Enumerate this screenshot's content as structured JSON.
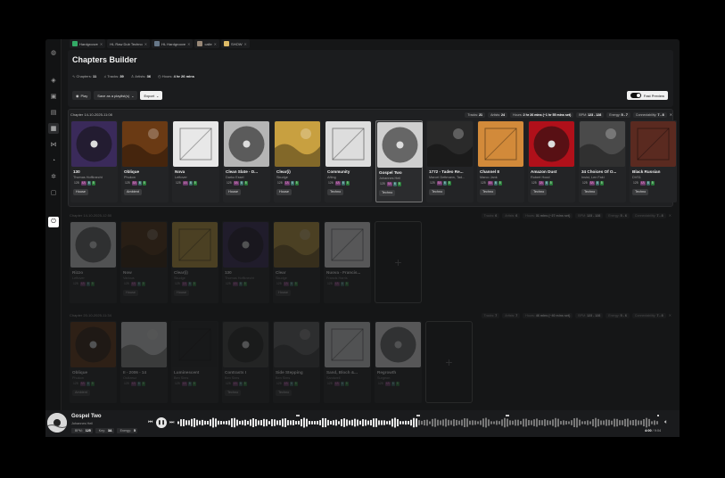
{
  "tabs": [
    {
      "label": "Hardgroove"
    },
    {
      "label": "HL Raw Dub Techno"
    },
    {
      "label": "HL Hardgroove"
    },
    {
      "label": "calle"
    },
    {
      "label": "SHOW"
    }
  ],
  "header": {
    "title": "Chapters Builder",
    "stats": {
      "chapters_label": "Chapters:",
      "chapters": "11",
      "tracks_label": "Tracks:",
      "tracks": "39",
      "artists_label": "Artists:",
      "artists": "36",
      "hours_label": "Hours:",
      "hours": "4 hr 26 mins"
    },
    "play_label": "Play",
    "save_label": "Save as a playlist(s)",
    "export_label": "Export",
    "fast_preview_label": "Fast Preview"
  },
  "chapters": [
    {
      "name": "Chapter 14-10-2025-11:08",
      "tracks_label": "Tracks:",
      "tracks": "21",
      "artists_label": "Artists:",
      "artists": "24",
      "hours_label": "Hours:",
      "hours": "2 hr 26 mins (~1 hr 55 mins set)",
      "bpm_label": "BPM:",
      "bpm": "123 - 128",
      "energy_label": "Energy:",
      "energy": "5 - 7",
      "connect_label": "Connectability:",
      "connect": "7 - 8"
    },
    {
      "name": "Chapter 14-10-2025-12:50",
      "tracks_label": "Tracks:",
      "tracks": "6",
      "artists_label": "Artists:",
      "artists": "6",
      "hours_label": "Hours:",
      "hours": "31 mins (~27 mins set)",
      "bpm_label": "BPM:",
      "bpm": "123 - 128",
      "energy_label": "Energy:",
      "energy": "5 - 6",
      "connect_label": "Connectability:",
      "connect": "7 - 8"
    },
    {
      "name": "Chapter 20-10-2025-11:34",
      "tracks_label": "Tracks:",
      "tracks": "7",
      "artists_label": "Artists:",
      "artists": "7",
      "hours_label": "Hours:",
      "hours": "46 mins (~40 mins set)",
      "bpm_label": "BPM:",
      "bpm": "123 - 128",
      "energy_label": "Energy:",
      "energy": "5 - 6",
      "connect_label": "Connectability:",
      "connect": "7 - 8"
    }
  ],
  "chapter1_tracks": [
    {
      "title": "130",
      "artist": "Thomas Hoffknecht",
      "bpm": "128",
      "key": "4A",
      "e1": "6",
      "e2": "5",
      "genre": "House",
      "cover": "#3a2a5a"
    },
    {
      "title": "Oblique",
      "artist": "Phukon",
      "bpm": "125",
      "key": "8A",
      "e1": "6",
      "e2": "5",
      "genre": "Ambient",
      "cover": "#6a3a14"
    },
    {
      "title": "Nova",
      "artist": "Leftover",
      "bpm": "125",
      "key": "4A",
      "e1": "6",
      "e2": "5",
      "genre": "",
      "cover": "#e8e8e8"
    },
    {
      "title": "Clean Slate - D...",
      "artist": "Darko Essel",
      "bpm": "125",
      "key": "5A",
      "e1": "6",
      "e2": "5",
      "genre": "House",
      "cover": "#b5b5b5"
    },
    {
      "title": "Clear(i)",
      "artist": "Skudge",
      "bpm": "128",
      "key": "1A",
      "e1": "6",
      "e2": "5",
      "genre": "House",
      "cover": "#c8a040"
    },
    {
      "title": "Community",
      "artist": "Afting",
      "bpm": "126",
      "key": "4A",
      "e1": "6",
      "e2": "5",
      "genre": "Techno",
      "cover": "#dddddd"
    },
    {
      "title": "Gospel Two",
      "artist": "Johannes Heil",
      "bpm": "125",
      "key": "5A",
      "e1": "6",
      "e2": "5",
      "genre": "Techno",
      "cover": "#cfcfcf"
    },
    {
      "title": "1772 - Tadeo Re...",
      "artist": "Marcel Dettmann, Tad...",
      "bpm": "125",
      "key": "8A",
      "e1": "6",
      "e2": "5",
      "genre": "Techno",
      "cover": "#2a2a2a"
    },
    {
      "title": "Channel 8",
      "artist": "Marco Jank",
      "bpm": "125",
      "key": "8A",
      "e1": "6",
      "e2": "5",
      "genre": "Techno",
      "cover": "#d28a3a"
    },
    {
      "title": "Amazon Dust",
      "artist": "Robert Hood",
      "bpm": "125",
      "key": "3A",
      "e1": "6",
      "e2": "5",
      "genre": "Techno",
      "cover": "#b0101a"
    },
    {
      "title": "34 Choices Of O...",
      "artist": "Insist, Len Faki",
      "bpm": "125",
      "key": "8A",
      "e1": "6",
      "e2": "5",
      "genre": "Techno",
      "cover": "#4a4a4a"
    },
    {
      "title": "Black Russian",
      "artist": "DVS1",
      "bpm": "125",
      "key": "4A",
      "e1": "6",
      "e2": "5",
      "genre": "Techno",
      "cover": "#5a2a20"
    }
  ],
  "chapter2_tracks": [
    {
      "title": "Rizzo",
      "artist": "Leftover",
      "bpm": "125",
      "key": "4A",
      "e1": "6",
      "e2": "5",
      "genre": "",
      "cover": "#ddd"
    },
    {
      "title": "Now",
      "artist": "Various",
      "bpm": "125",
      "key": "4A",
      "e1": "6",
      "e2": "5",
      "genre": "House",
      "cover": "#553311"
    },
    {
      "title": "Clear(i)",
      "artist": "Skudge",
      "bpm": "125",
      "key": "1A",
      "e1": "6",
      "e2": "5",
      "genre": "House",
      "cover": "#c8a040"
    },
    {
      "title": "130",
      "artist": "Thomas Hoffknecht",
      "bpm": "125",
      "key": "4A",
      "e1": "6",
      "e2": "5",
      "genre": "",
      "cover": "#3a2a5a"
    },
    {
      "title": "Clear",
      "artist": "Skudge",
      "bpm": "125",
      "key": "1A",
      "e1": "6",
      "e2": "5",
      "genre": "House",
      "cover": "#c8a040"
    },
    {
      "title": "Nuova - Francis...",
      "artist": "Francis Harris",
      "bpm": "125",
      "key": "4A",
      "e1": "6",
      "e2": "5",
      "genre": "",
      "cover": "#eee"
    }
  ],
  "chapter3_tracks": [
    {
      "title": "Oblique",
      "artist": "Phukon",
      "bpm": "125",
      "key": "8A",
      "e1": "6",
      "e2": "5",
      "genre": "Ambient",
      "cover": "#6a3a14"
    },
    {
      "title": "II - 2006 - 14",
      "artist": "Ostkreuz",
      "bpm": "125",
      "key": "4A",
      "e1": "6",
      "e2": "5",
      "genre": "",
      "cover": "#ddd"
    },
    {
      "title": "Luminescent",
      "artist": "Ben Sims",
      "bpm": "125",
      "key": "4A",
      "e1": "6",
      "e2": "5",
      "genre": "",
      "cover": "#222"
    },
    {
      "title": "Contrasts I",
      "artist": "Ben Sims",
      "bpm": "125",
      "key": "4A",
      "e1": "6",
      "e2": "5",
      "genre": "Techno",
      "cover": "#444"
    },
    {
      "title": "Side Stepping",
      "artist": "Ben Sims",
      "bpm": "125",
      "key": "4A",
      "e1": "6",
      "e2": "5",
      "genre": "Techno",
      "cover": "#666"
    },
    {
      "title": "Sand, Bloch &...",
      "artist": "Sandwell",
      "bpm": "125",
      "key": "4A",
      "e1": "6",
      "e2": "5",
      "genre": "",
      "cover": "#ddd"
    },
    {
      "title": "Regrowth",
      "artist": "Surgeon",
      "bpm": "125",
      "key": "4A",
      "e1": "6",
      "e2": "5",
      "genre": "",
      "cover": "#eee"
    }
  ],
  "player": {
    "title": "Gospel Two",
    "artist": "Johannes Heil",
    "bpm_label": "BPM:",
    "bpm": "125",
    "key_label": "Key:",
    "key": "3A",
    "energy_label": "Energy:",
    "energy": "5",
    "time_current": "4:00",
    "time_total": "9:04",
    "progress": 0.5
  },
  "icons": [
    "globe-icon",
    "layers-icon",
    "folder-add-icon",
    "folder-icon",
    "crate-icon",
    "share-icon",
    "history-icon",
    "settings-icon",
    "robot-icon",
    "power-icon"
  ]
}
